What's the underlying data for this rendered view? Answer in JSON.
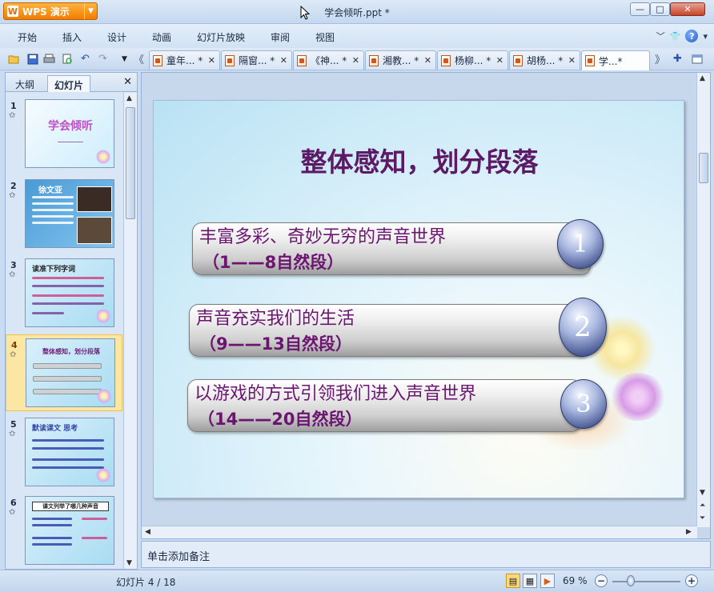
{
  "window": {
    "app_button": "WPS 演示",
    "title": "学会倾听.ppt *",
    "minimize": "—",
    "maximize": "□",
    "close": "✕"
  },
  "menu": [
    "开始",
    "插入",
    "设计",
    "动画",
    "幻灯片放映",
    "审阅",
    "视图"
  ],
  "toolbar_icons": [
    "open-icon",
    "save-icon",
    "print-icon",
    "print-preview-icon",
    "undo-icon",
    "redo-icon",
    "dropdown-icon",
    "tab-scroll-left-icon"
  ],
  "tabs": [
    {
      "label": "童年... *",
      "close": "✕"
    },
    {
      "label": "隔窗... *",
      "close": "✕"
    },
    {
      "label": "《神... *",
      "close": "✕"
    },
    {
      "label": "湘教... *",
      "close": "✕"
    },
    {
      "label": "杨柳... *",
      "close": "✕"
    },
    {
      "label": "胡杨... *",
      "close": "✕"
    },
    {
      "label": "学...*",
      "close": ""
    }
  ],
  "left_panel": {
    "tab_outline": "大纲",
    "tab_slides": "幻灯片",
    "close": "✕"
  },
  "thumbnails": [
    {
      "num": "1",
      "star": "✩",
      "title": "学会倾听"
    },
    {
      "num": "2",
      "star": "✩",
      "title": "徐文亚"
    },
    {
      "num": "3",
      "star": "✩",
      "title": "读准下列字词"
    },
    {
      "num": "4",
      "star": "✩",
      "title": "整体感知，划分段落"
    },
    {
      "num": "5",
      "star": "✩",
      "title": "默读课文 思考"
    },
    {
      "num": "6",
      "star": "✩",
      "title": "课文列举了哪几种声音"
    }
  ],
  "slide": {
    "title": "整体感知，划分段落",
    "items": [
      {
        "text": "丰富多彩、奇妙无穷的声音世界",
        "range": "（1——8自然段）",
        "badge": "1"
      },
      {
        "text": "声音充实我们的生活",
        "range": "（9——13自然段）",
        "badge": "2"
      },
      {
        "text": "以游戏的方式引领我们进入声音世界",
        "range": "（14——20自然段）",
        "badge": "3"
      }
    ]
  },
  "notes": {
    "placeholder": "单击添加备注"
  },
  "status": {
    "slide_counter": "幻灯片 4 / 18",
    "zoom": "69 %"
  },
  "colors": {
    "slide_title": "#5c1a66",
    "bar_text": "#6b1570",
    "app_orange": "#f07d00"
  }
}
